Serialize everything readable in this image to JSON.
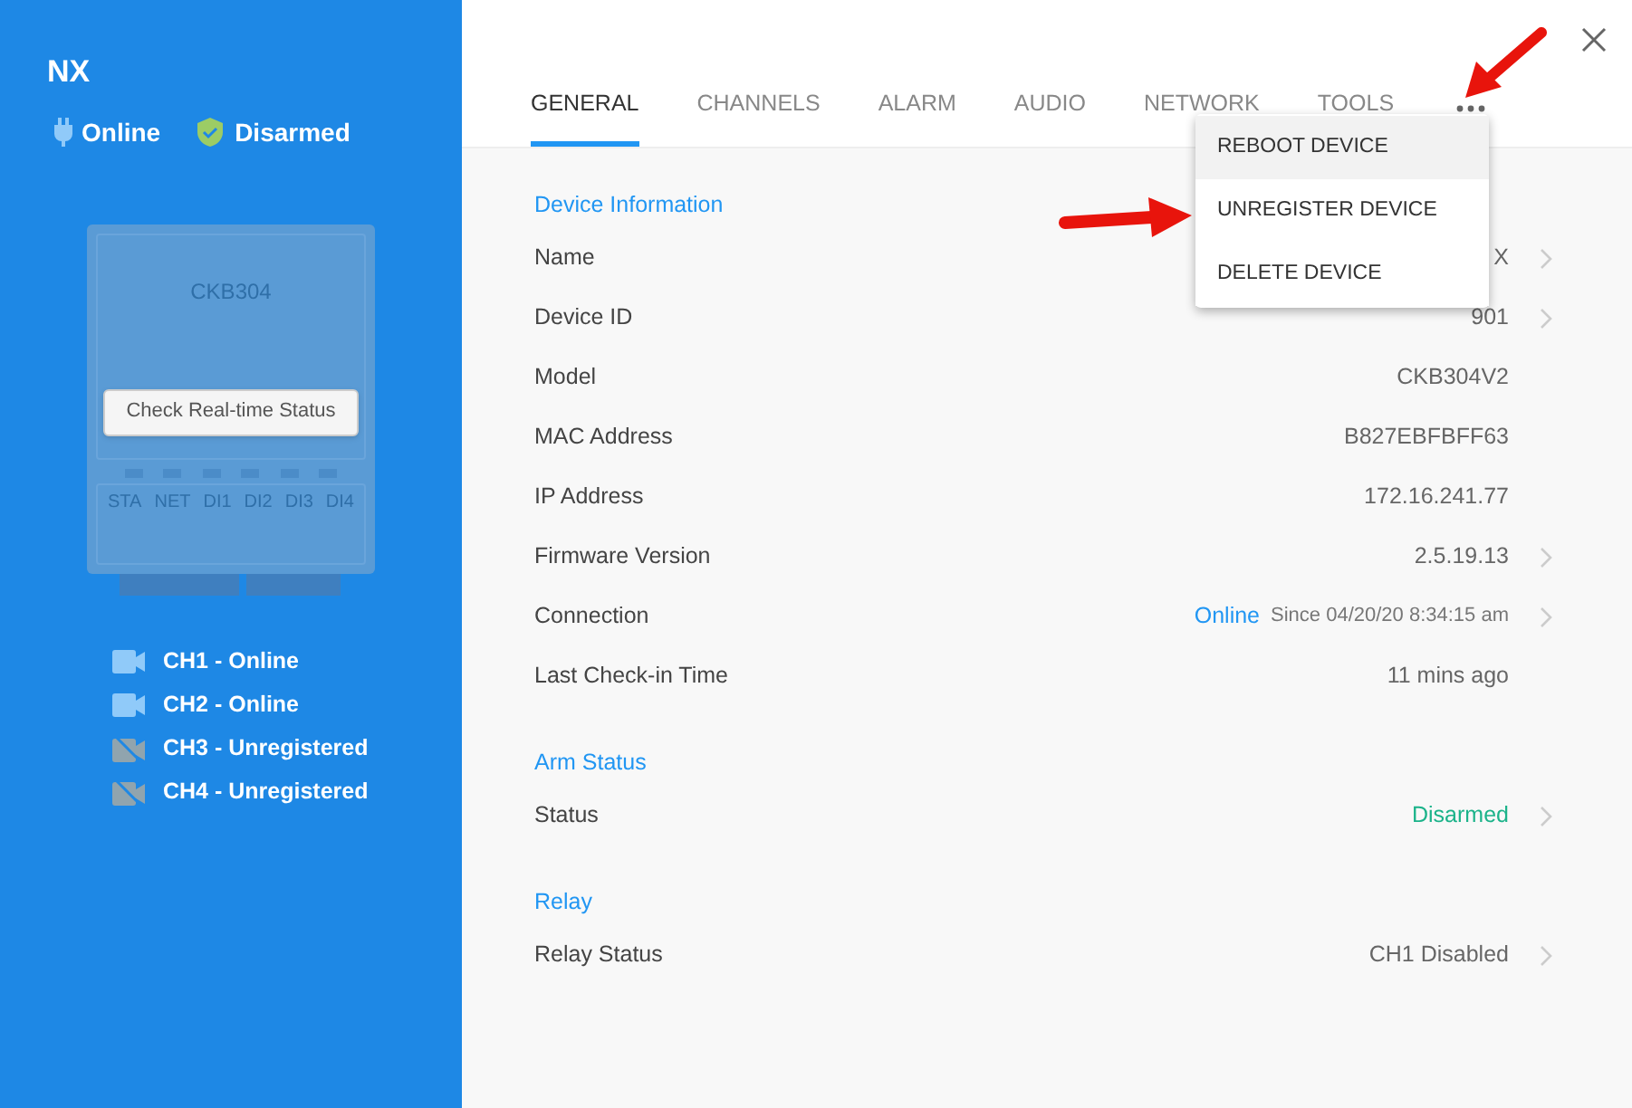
{
  "device": {
    "name": "NX",
    "connection": "Online",
    "arm_status": "Disarmed"
  },
  "panel": {
    "model_label": "CKB304",
    "button": "Check Real-time Status",
    "ports": [
      "STA",
      "NET",
      "DI1",
      "DI2",
      "DI3",
      "DI4"
    ]
  },
  "channels": [
    {
      "label": "CH1 - Online",
      "registered": true
    },
    {
      "label": "CH2 - Online",
      "registered": true
    },
    {
      "label": "CH3 - Unregistered",
      "registered": false
    },
    {
      "label": "CH4 - Unregistered",
      "registered": false
    }
  ],
  "tabs": [
    {
      "label": "GENERAL",
      "selected": true
    },
    {
      "label": "CHANNELS",
      "selected": false
    },
    {
      "label": "ALARM",
      "selected": false
    },
    {
      "label": "AUDIO",
      "selected": false
    },
    {
      "label": "NETWORK",
      "selected": false
    },
    {
      "label": "TOOLS",
      "selected": false
    }
  ],
  "more_menu": {
    "items": [
      {
        "label": "REBOOT DEVICE",
        "selected": true
      },
      {
        "label": "UNREGISTER DEVICE",
        "selected": false
      },
      {
        "label": "DELETE DEVICE",
        "selected": false
      }
    ]
  },
  "sections": [
    {
      "title": "Device Information",
      "rows": [
        {
          "label": "Name",
          "value": "X",
          "kind": "plain",
          "expandable": true
        },
        {
          "label": "Device ID",
          "value": "901",
          "kind": "plain",
          "expandable": true
        },
        {
          "label": "Model",
          "value": "CKB304V2",
          "kind": "plain",
          "expandable": false
        },
        {
          "label": "MAC Address",
          "value": "B827EBFBFF63",
          "kind": "plain",
          "expandable": false
        },
        {
          "label": "IP Address",
          "value": "172.16.241.77",
          "kind": "plain",
          "expandable": false
        },
        {
          "label": "Firmware Version",
          "value": "2.5.19.13",
          "kind": "plain",
          "expandable": true
        },
        {
          "label": "Connection",
          "value": "Online",
          "note": "Since 04/20/20 8:34:15 am",
          "kind": "info",
          "expandable": true
        },
        {
          "label": "Last Check-in Time",
          "value": "11 mins ago",
          "kind": "plain",
          "expandable": false
        }
      ]
    },
    {
      "title": "Arm Status",
      "rows": [
        {
          "label": "Status",
          "value": "Disarmed",
          "kind": "success",
          "expandable": true
        }
      ]
    },
    {
      "title": "Relay",
      "rows": [
        {
          "label": "Relay Status",
          "value": "CH1 Disabled",
          "kind": "plain",
          "expandable": true
        }
      ]
    }
  ]
}
